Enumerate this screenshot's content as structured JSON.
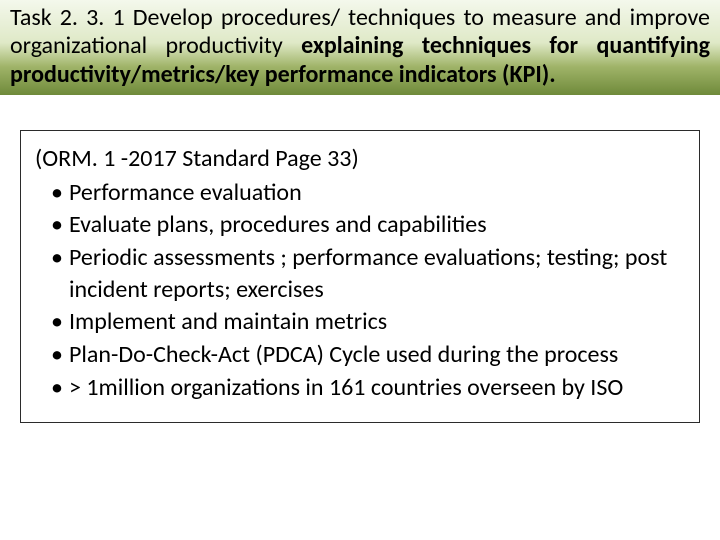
{
  "title": {
    "plain": "Task 2. 3. 1 Develop procedures/ techniques to measure and improve organizational productivity ",
    "bold": "explaining techniques for quantifying productivity/metrics/key performance indicators (KPI)."
  },
  "content": {
    "reference": "(ORM. 1 -2017 Standard Page 33)",
    "bullets": [
      "Performance evaluation",
      "Evaluate plans, procedures and capabilities",
      "Periodic assessments ; performance evaluations; testing; post incident reports; exercises",
      "Implement and maintain metrics",
      "Plan-Do-Check-Act (PDCA) Cycle used during the process",
      "> 1million organizations in 161 countries overseen by ISO"
    ]
  }
}
